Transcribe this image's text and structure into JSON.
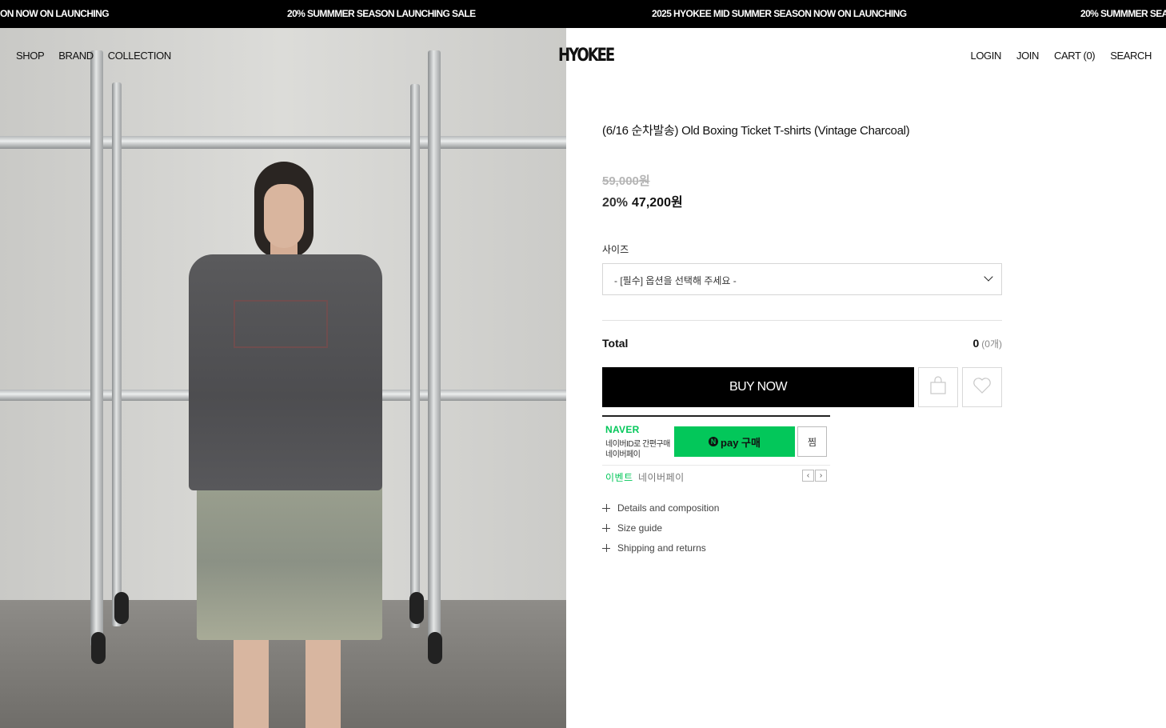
{
  "marquee": {
    "items": [
      "ON NOW ON LAUNCHING",
      "20% SUMMMER SEASON LAUNCHING SALE",
      "2025 HYOKEE MID SUMMER SEASON NOW ON LAUNCHING",
      "20% SUMMMER SEA"
    ]
  },
  "nav": {
    "left": [
      "SHOP",
      "BRAND",
      "COLLECTION"
    ],
    "logo": "HYOKEE",
    "right": [
      "LOGIN",
      "JOIN",
      "CART (0)",
      "SEARCH"
    ]
  },
  "product": {
    "title": "(6/16 순차발송) Old Boxing Ticket T-shirts (Vintage Charcoal)",
    "original_price": "59,000원",
    "discount": "20%",
    "sale_price": "47,200원",
    "option_label": "사이즈",
    "option_placeholder": "- [필수] 옵션을 선택해 주세요 -",
    "total_label": "Total",
    "total_value": "0",
    "total_count": "(0개)",
    "buy_label": "BUY NOW"
  },
  "naverpay": {
    "brand": "NAVER",
    "line1": "네이버ID로 간편구매",
    "line2": "네이버페이",
    "pay_badge": "N",
    "pay_label": "pay 구매",
    "jjim_label": "찜",
    "event_tag": "이벤트",
    "event_text": "네이버페이",
    "prev": "‹",
    "next": "›"
  },
  "accordions": [
    "Details and composition",
    "Size guide",
    "Shipping and returns"
  ],
  "colors": {
    "naver_green": "#03c75a",
    "buy_bg": "#000000"
  }
}
